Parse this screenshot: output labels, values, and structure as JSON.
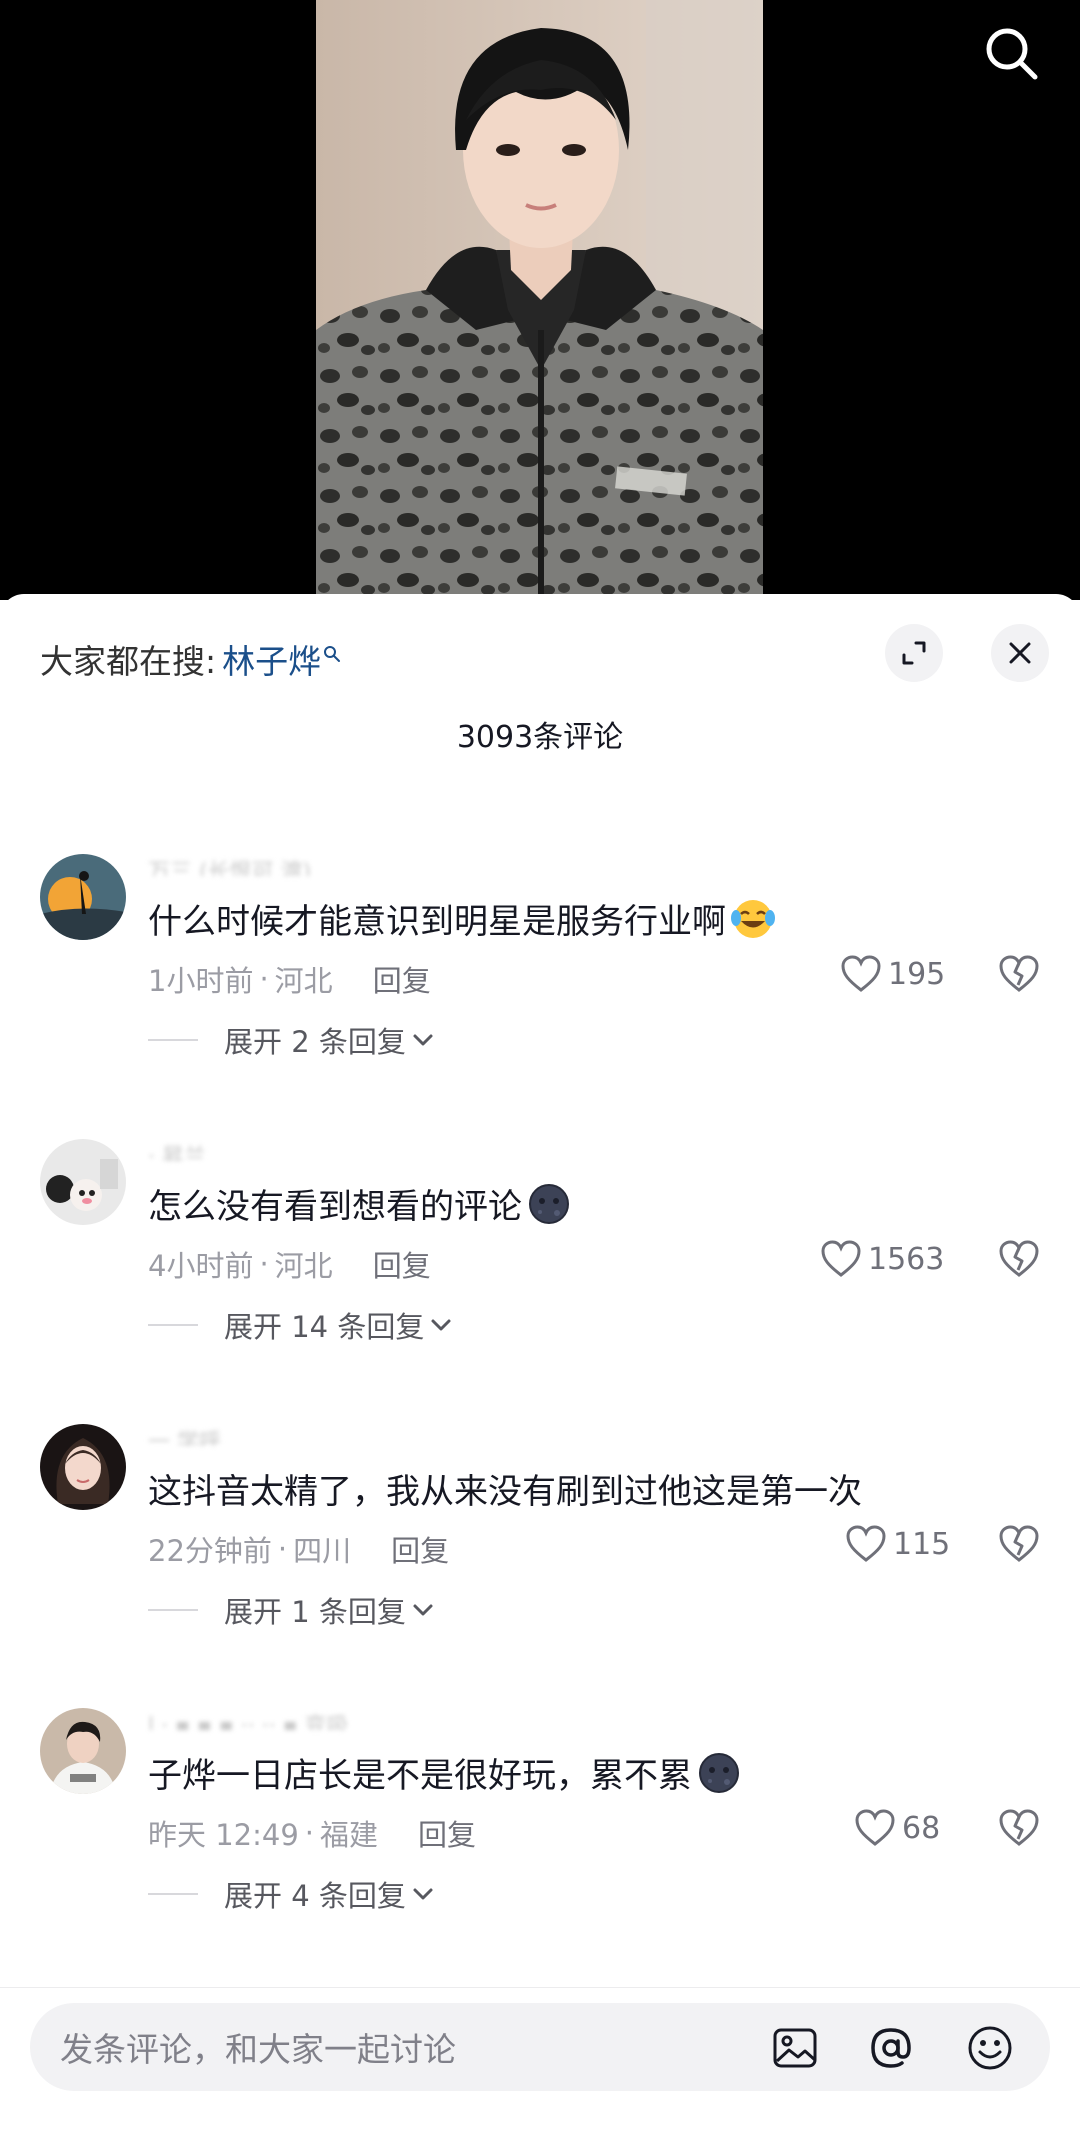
{
  "search_suggest": {
    "prefix": "大家都在搜:",
    "term": "林子烨"
  },
  "comment_count_label": "3093条评论",
  "comments": [
    {
      "username": "万三 (长恨可 渡)",
      "text": "什么时候才能意识到明星是服务行业啊",
      "emoji": "crying-laughing-emoji",
      "time": "1小时前",
      "location": "河北",
      "reply_label": "回复",
      "likes": "195",
      "expand_label": "展开 2 条回复"
    },
    {
      "username": "·  昇兰",
      "text": "怎么没有看到想看的评论",
      "emoji": "dark-moon-face-emoji",
      "time": "4小时前",
      "location": "河北",
      "reply_label": "回复",
      "likes": "1563",
      "expand_label": "展开 14 条回复"
    },
    {
      "username": "一  学呼",
      "text": "这抖音太精了，我从来没有刷到过他这是第一次",
      "emoji": "",
      "time": "22分钟前",
      "location": "四川",
      "reply_label": "回复",
      "likes": "115",
      "expand_label": "展开 1 条回复"
    },
    {
      "username": "l    ·    ▪  ▪ ▪ ··  ·· ▪ 变吸",
      "text": "子烨一日店长是不是很好玩，累不累",
      "emoji": "dark-moon-face-emoji",
      "time": "昨天 12:49",
      "location": "福建",
      "reply_label": "回复",
      "likes": "68",
      "expand_label": "展开 4 条回复"
    }
  ],
  "separator": "·",
  "input": {
    "placeholder": "发条评论，和大家一起讨论"
  },
  "colors": {
    "accent_link": "#1b4f8a",
    "text_primary": "#161823",
    "text_secondary": "#9b9ca4",
    "input_bg": "#f2f2f4"
  }
}
